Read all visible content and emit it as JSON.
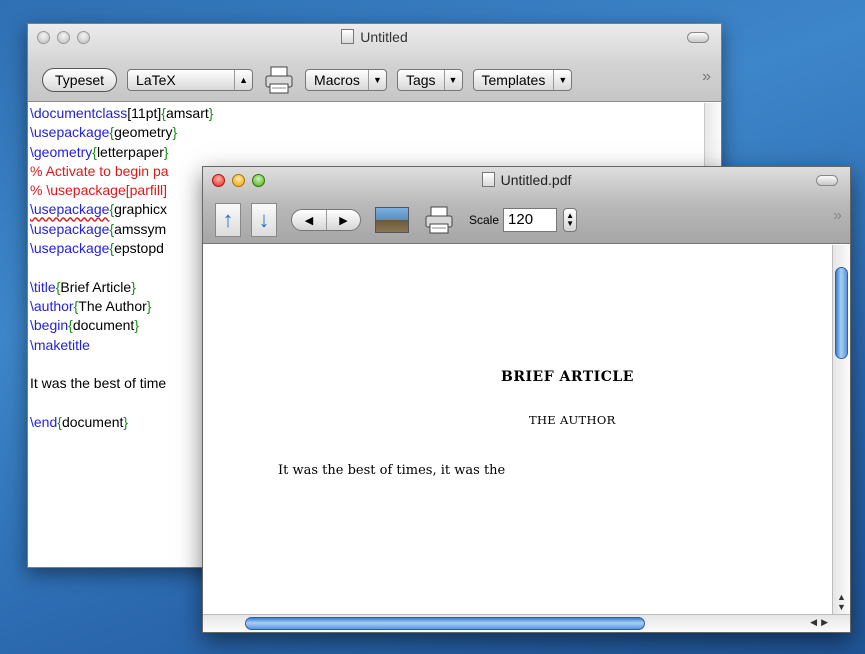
{
  "editor": {
    "title": "Untitled",
    "toolbar": {
      "typeset_label": "Typeset",
      "engine_value": "LaTeX",
      "macros_label": "Macros",
      "tags_label": "Tags",
      "templates_label": "Templates"
    },
    "lines": {
      "l1_cmd": "\\documentclass",
      "l1_opt": "[11pt]",
      "l1_ob": "{",
      "l1_arg": "amsart",
      "l1_cb": "}",
      "l2_cmd": "\\usepackage",
      "l2_ob": "{",
      "l2_arg": "geometry",
      "l2_cb": "}",
      "l3_cmd": "\\geometry",
      "l3_ob": "{",
      "l3_arg": "letterpaper",
      "l3_cb": "}",
      "l4_comment": "% Activate to begin pa",
      "l5_comment": "% \\usepackage[parfill]",
      "l6_cmd": "\\usepackage",
      "l6_ob": "{",
      "l6_arg": "graphicx",
      "l7_cmd": "\\usepackage",
      "l7_ob": "{",
      "l7_arg": "amssym",
      "l8_cmd": "\\usepackage",
      "l8_ob": "{",
      "l8_arg": "epstopd",
      "l10_cmd": "\\title",
      "l10_ob": "{",
      "l10_arg": "Brief Article",
      "l10_cb": "}",
      "l11_cmd": "\\author",
      "l11_ob": "{",
      "l11_arg": "The Author",
      "l11_cb": "}",
      "l12_cmd": "\\begin",
      "l12_ob": "{",
      "l12_arg": "document",
      "l12_cb": "}",
      "l13_cmd": "\\maketitle",
      "l15_text": "It was the best of time",
      "l17_cmd": "\\end",
      "l17_ob": "{",
      "l17_arg": "document",
      "l17_cb": "}"
    }
  },
  "pdf": {
    "title": "Untitled.pdf",
    "scale_label": "Scale",
    "scale_value": "120",
    "page": {
      "title": "BRIEF ARTICLE",
      "author": "THE AUTHOR",
      "body": "It was the best of times, it was the"
    }
  },
  "colors": {
    "command": "#2222dd",
    "brace": "#158c15",
    "comment": "#e01818"
  }
}
